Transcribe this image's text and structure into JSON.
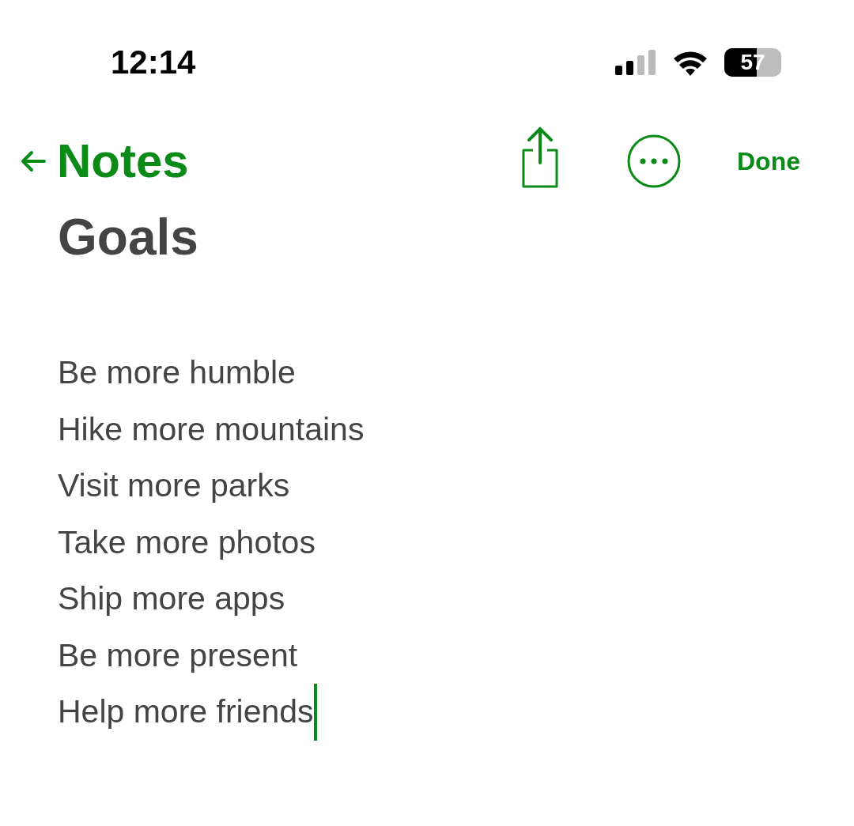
{
  "status_bar": {
    "time": "12:14",
    "battery": "57"
  },
  "nav": {
    "back": "Notes",
    "done": "Done"
  },
  "note": {
    "title": "Goals",
    "editing": true,
    "lines": [
      "Be more humble",
      "Hike more mountains",
      "Visit more parks",
      "Take more photos",
      "Ship more apps",
      "Be more present",
      "Help more friends"
    ]
  }
}
